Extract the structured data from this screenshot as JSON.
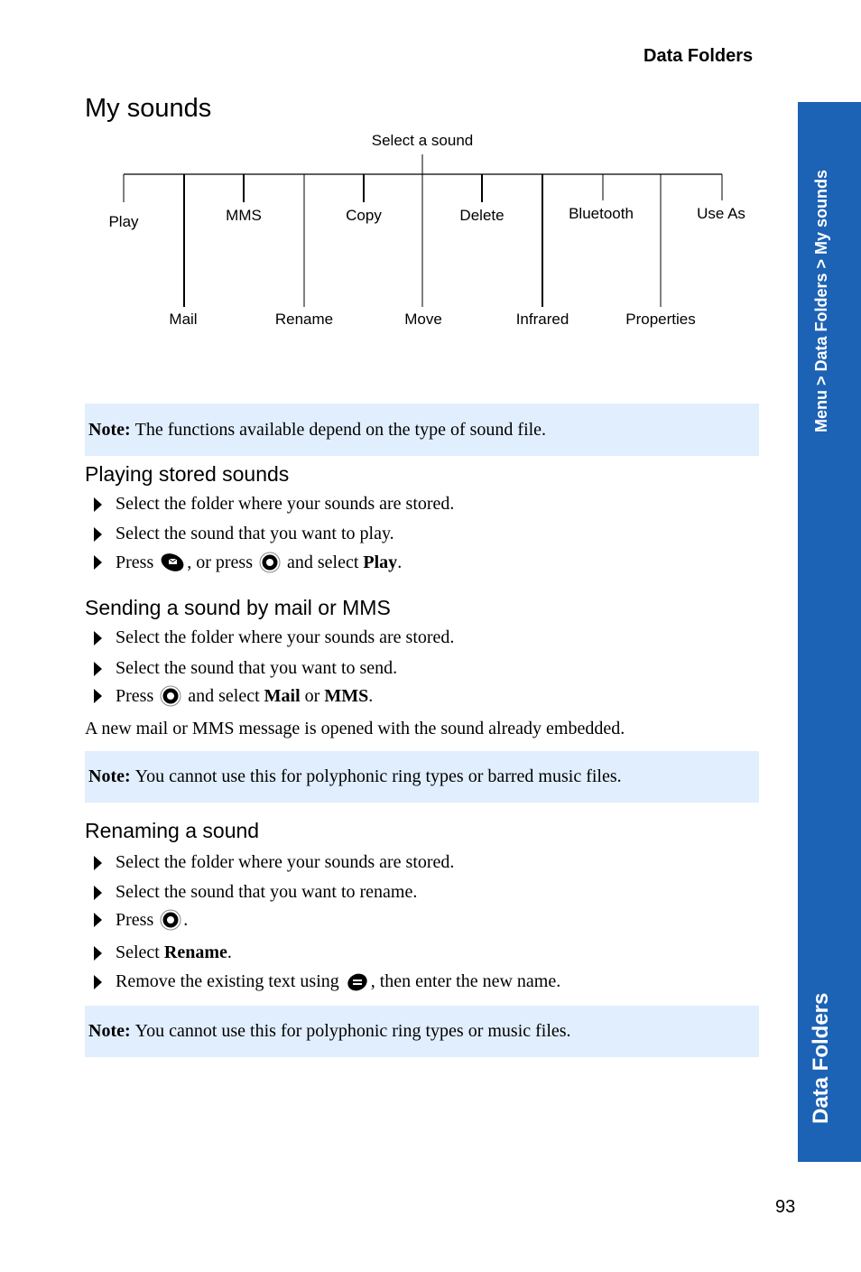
{
  "header": {
    "section_title": "Data Folders"
  },
  "page": {
    "title": "My sounds",
    "number": "93"
  },
  "sidebar": {
    "breadcrumb": "Menu > Data Folders > My sounds",
    "section_tab": "Data Folders",
    "color": "#1c62b5"
  },
  "diagram": {
    "root": "Select a sound",
    "upper_options": [
      "Play",
      "MMS",
      "Copy",
      "Delete",
      "Bluetooth",
      "Use As"
    ],
    "lower_options": [
      "Mail",
      "Rename",
      "Move",
      "Infrared",
      "Properties"
    ]
  },
  "notes": [
    {
      "label": "Note:",
      "text": "The functions available depend on the type of sound file."
    },
    {
      "label": "Note:",
      "text": "You cannot use this for polyphonic ring types or barred music files."
    },
    {
      "label": "Note:",
      "text": "You cannot use this for polyphonic ring types or music files."
    }
  ],
  "sections": {
    "playing": {
      "heading": "Playing stored sounds",
      "steps": [
        "Select the folder where your sounds are stored.",
        "Select the sound that you want to play."
      ],
      "step3": {
        "press": "Press",
        "or_press": ", or press",
        "and_select": "and select",
        "option": "Play",
        "end": "."
      }
    },
    "sending": {
      "heading": "Sending a sound by mail or MMS",
      "steps": [
        "Select the folder where your sounds are stored.",
        "Select the sound that you want to send."
      ],
      "step3": {
        "press": "Press",
        "and_select": "and select",
        "option1": "Mail",
        "or": "or",
        "option2": "MMS",
        "end": "."
      },
      "result": "A new mail or MMS message is opened with the sound already embedded."
    },
    "renaming": {
      "heading": "Renaming a sound",
      "steps": [
        "Select the folder where your sounds are stored.",
        "Select the sound that you want to rename."
      ],
      "step3": {
        "press": "Press",
        "end": "."
      },
      "step4": {
        "select": "Select",
        "option": "Rename",
        "end": "."
      },
      "step5": {
        "before": "Remove the existing text using",
        "after": ", then enter the new name."
      }
    }
  },
  "icons": {
    "message_key": "message-key-icon",
    "center_key": "center-select-key-icon",
    "clear_key": "clear-key-icon"
  }
}
